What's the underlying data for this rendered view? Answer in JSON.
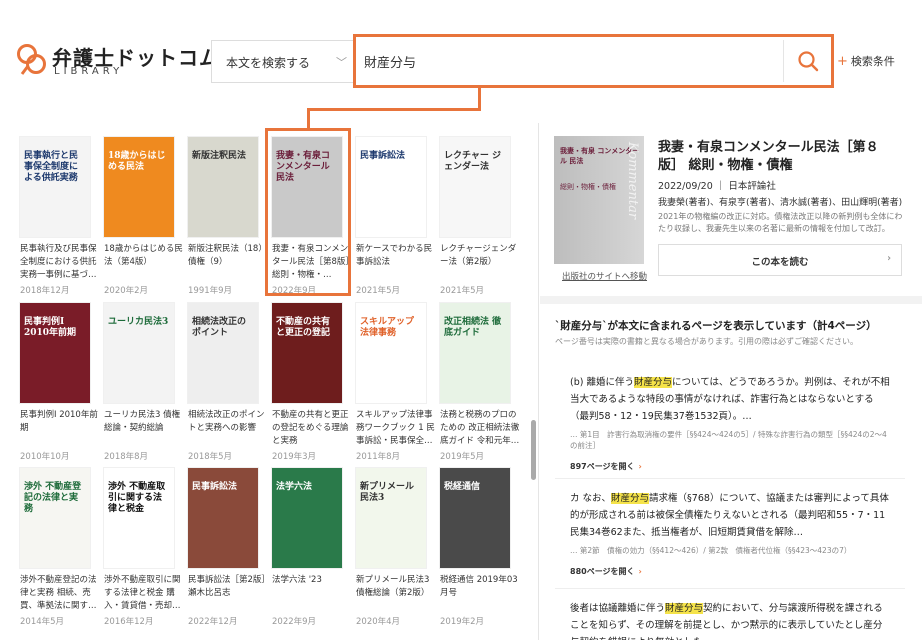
{
  "header": {
    "logo_title": "弁護士ドットコム",
    "logo_sub": "LIBRARY",
    "scope_label": "本文を検索する",
    "search_value": "財産分与",
    "advanced_label": "検索条件"
  },
  "books": [
    {
      "title": "民事執行及び民事保全制度における供託実務一事例に基づ…",
      "date": "2018年12月",
      "cover": {
        "bg": "#f4f4f4",
        "fg": "#1e3a6e",
        "text": "民事執行と民事保全制度による供託実務"
      }
    },
    {
      "title": "18歳からはじめる民法（第4版）",
      "date": "2020年2月",
      "cover": {
        "bg": "#ef8a1f",
        "fg": "#ffffff",
        "text": "18歳からはじめる民法"
      }
    },
    {
      "title": "新版注釈民法（18）債権（9）",
      "date": "1991年9月",
      "cover": {
        "bg": "#d8d8ce",
        "fg": "#333333",
        "text": "新版注釈民法"
      }
    },
    {
      "title": "我妻・有泉コンメンタール民法［第8版］総則・物権・…",
      "date": "2022年9月",
      "cover": {
        "bg": "#c9c9c9",
        "fg": "#6b1e3a",
        "text": "我妻・有泉コンメンタール民法"
      }
    },
    {
      "title": "新ケースでわかる民事訴訟法",
      "date": "2021年5月",
      "cover": {
        "bg": "#ffffff",
        "fg": "#1e3a6e",
        "text": "民事訴訟法"
      }
    },
    {
      "title": "レクチャージェンダー法（第2版）",
      "date": "2021年5月",
      "cover": {
        "bg": "#f7f7f7",
        "fg": "#333333",
        "text": "レクチャー ジェンダー法"
      }
    },
    {
      "title": "民事判例Ⅰ 2010年前期",
      "date": "2010年10月",
      "cover": {
        "bg": "#7a1c28",
        "fg": "#ffffff",
        "text": "民事判例Ⅰ 2010年前期"
      }
    },
    {
      "title": "ユーリカ民法3 債権総論・契約総論",
      "date": "2018年8月",
      "cover": {
        "bg": "#f3f3f3",
        "fg": "#1d6b3a",
        "text": "ユーリカ民法3"
      }
    },
    {
      "title": "相続法改正のポイントと実務への影響",
      "date": "2018年5月",
      "cover": {
        "bg": "#eeeeee",
        "fg": "#333333",
        "text": "相続法改正のポイント"
      }
    },
    {
      "title": "不動産の共有と更正の登記をめぐる理論と実務",
      "date": "2019年3月",
      "cover": {
        "bg": "#6e1d1d",
        "fg": "#ffffff",
        "text": "不動産の共有と更正の登記"
      }
    },
    {
      "title": "スキルアップ法律事務ワークブック 1 民事訴訟・民事保全…",
      "date": "2011年8月",
      "cover": {
        "bg": "#ffffff",
        "fg": "#e0622a",
        "text": "スキルアップ 法律事務"
      }
    },
    {
      "title": "法務と税務のプロのための 改正相続法徹底ガイド 令和元年…",
      "date": "2019年5月",
      "cover": {
        "bg": "#e8f3e6",
        "fg": "#1d6b3a",
        "text": "改正相続法 徹底ガイド"
      }
    },
    {
      "title": "渉外不動産登記の法律と実務 相続、売買、準拠法に関す…",
      "date": "2014年5月",
      "cover": {
        "bg": "#f6f6f2",
        "fg": "#1e6b3a",
        "text": "渉外 不動産登記の法律と実務"
      }
    },
    {
      "title": "渉外不動産取引に関する法律と税金 購入・賃貸借・売却…",
      "date": "2016年12月",
      "cover": {
        "bg": "#ffffff",
        "fg": "#111111",
        "text": "渉外 不動産取引に関する法律と税金"
      }
    },
    {
      "title": "民事訴訟法［第2版］瀬木比呂志",
      "date": "2022年12月",
      "cover": {
        "bg": "#8a4a3a",
        "fg": "#ffffff",
        "text": "民事訴訟法"
      }
    },
    {
      "title": "法学六法 '23",
      "date": "2022年9月",
      "cover": {
        "bg": "#2a7a4a",
        "fg": "#ffffff",
        "text": "法学六法"
      }
    },
    {
      "title": "新プリメール民法3 債権総論（第2版）",
      "date": "2020年4月",
      "cover": {
        "bg": "#f2f7ec",
        "fg": "#333333",
        "text": "新プリメール民法3"
      }
    },
    {
      "title": "税経通信 2019年03月号",
      "date": "2019年2月",
      "cover": {
        "bg": "#4a4a4a",
        "fg": "#ffffff",
        "text": "税経通信"
      }
    }
  ],
  "detail": {
    "title": "我妻・有泉コンメンタール民法［第８版］ 総則・物権・債権",
    "date": "2022/09/20",
    "publisher": "日本評論社",
    "authors": "我妻榮(著者)、有泉亨(著者)、清水誠(著者)、田山輝明(著者)",
    "description": "2021年の物権編の改正に対応。債権法改正以降の新判例も全体にわたり収録し、我妻先生以来の名著に最新の情報を付加して改訂。",
    "read_label": "この本を読む",
    "publisher_link": "出版社のサイトへ移動",
    "cover_text": "我妻・有泉 コンメンタール 民法",
    "cover_sub": "総則・物権・債権"
  },
  "results": {
    "heading": "`財産分与`が本文に含まれるページを表示しています（計4ページ）",
    "note": "ページ番号は実際の書籍と異なる場合があります。引用の際は必ずご確認ください。",
    "hits": [
      {
        "pre": "(b) 離婚に伴う",
        "hl": "財産分与",
        "post": "については、どうであろうか。判例は、それが不相当大であるような特段の事情がなければ、詐害行為とはならないとする（最判58・12・19民集37巻1532頁）。…",
        "path": "… 第1目　詐害行為取消権の要件［§§424〜424の5］/ 特殊な詐害行為の類型［§§424の2〜4の前注］",
        "open": "897ページを開く"
      },
      {
        "pre": "カ なお、",
        "hl": "財産分与",
        "post": "請求権（§768）について、協議または審判によって具体的が形成される前は被保全債権たりえないとされる（最判昭和55・7・11民集34巻62また、抵当権者が、旧短期賃貸借を解除…",
        "path": "… 第2節　債権の効力（§§412〜426）/ 第2款　債権者代位権（§§423〜423の7）",
        "open": "880ページを開く"
      },
      {
        "pre": "後者は協議離婚に伴う",
        "hl": "財産分与",
        "post": "契約において、分与譲渡所得税を課されることを知らず、その理解を前提とし、かつ黙示的に表示していたとし産分与契約を錯誤により無効とした",
        "path": "",
        "open": ""
      }
    ]
  }
}
